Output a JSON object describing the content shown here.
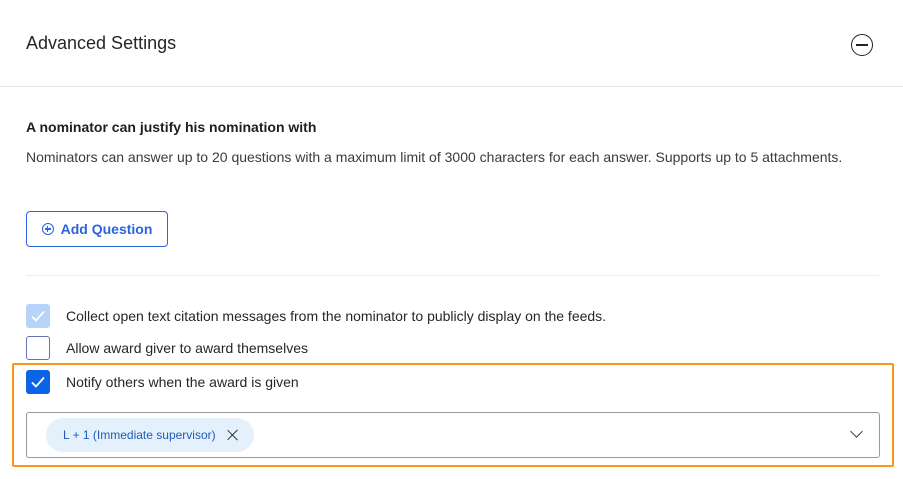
{
  "header": {
    "title": "Advanced Settings",
    "collapse_icon": "minus-circle-icon"
  },
  "justification": {
    "title": "A nominator can justify his nomination with",
    "description": "Nominators can answer up to 20 questions with a maximum limit of 3000 characters for each answer. Supports up to 5 attachments.",
    "add_question_label": "Add Question",
    "add_question_icon": "plus-circle-icon"
  },
  "options": [
    {
      "label": "Collect open text citation messages from the nominator to publicly display on the feeds.",
      "state": "checked-disabled"
    },
    {
      "label": "Allow award giver to award themselves",
      "state": "unchecked"
    },
    {
      "label": "Notify others when the award is given",
      "state": "checked"
    }
  ],
  "notify_select": {
    "chips": [
      {
        "label": "L + 1 (Immediate supervisor)"
      }
    ],
    "dropdown_icon": "chevron-down-icon"
  },
  "colors": {
    "accent": "#0b63e5",
    "link": "#2b63e0",
    "highlight": "#f7981d",
    "chip_bg": "#e4f0fb",
    "checkbox_disabled": "#b7d3f7"
  }
}
